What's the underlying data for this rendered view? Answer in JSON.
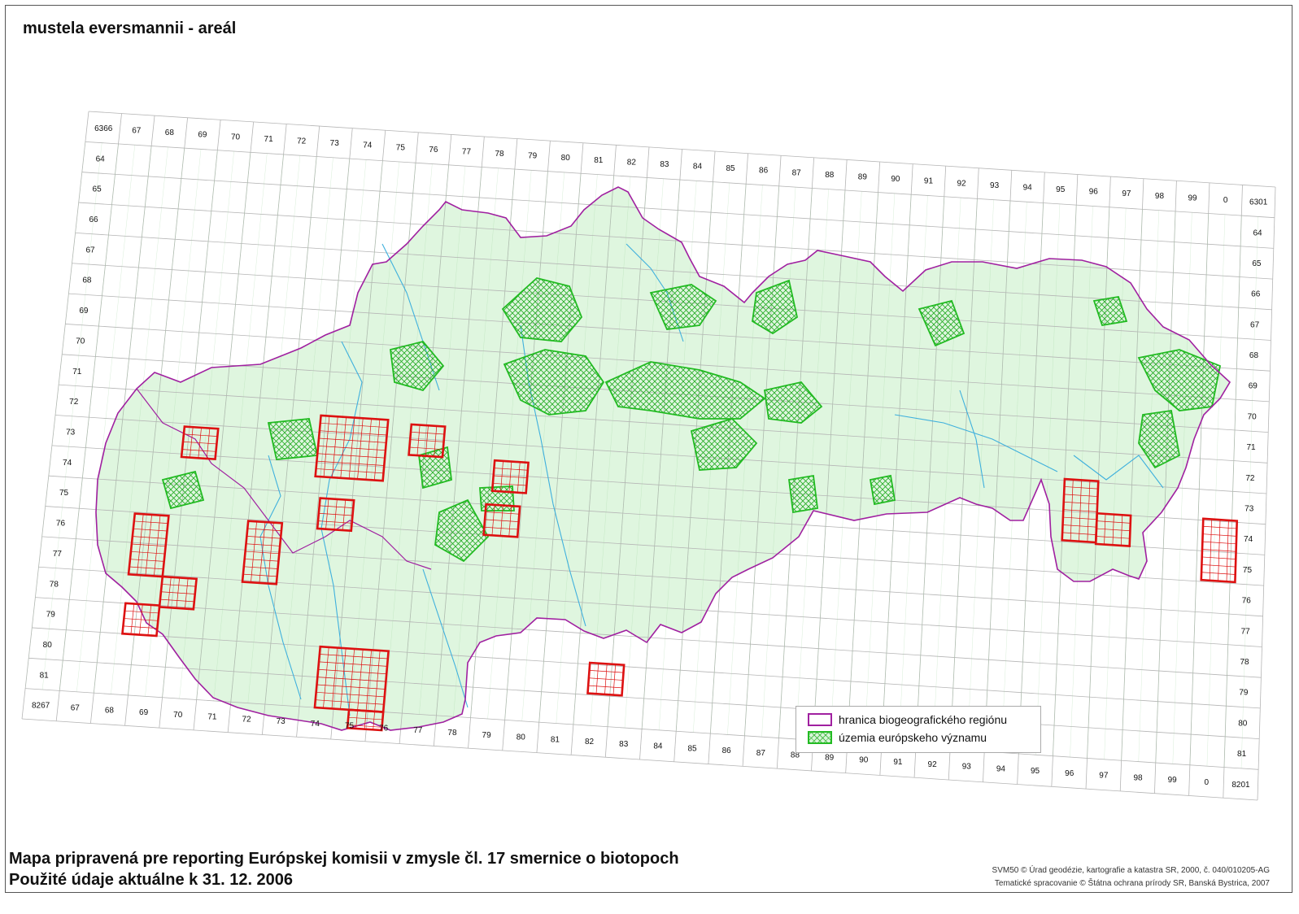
{
  "map": {
    "title": "mustela eversmannii - areál",
    "top_labels": [
      "6366",
      "67",
      "68",
      "69",
      "70",
      "71",
      "72",
      "73",
      "74",
      "75",
      "76",
      "77",
      "78",
      "79",
      "80",
      "81",
      "82",
      "83",
      "84",
      "85",
      "86",
      "87",
      "88",
      "89",
      "90",
      "91",
      "92",
      "93",
      "94",
      "95",
      "96",
      "97",
      "98",
      "99",
      "0",
      "6301"
    ],
    "bottom_labels": [
      "8267",
      "67",
      "68",
      "69",
      "70",
      "71",
      "72",
      "73",
      "74",
      "75",
      "76",
      "77",
      "78",
      "79",
      "80",
      "81",
      "82",
      "83",
      "84",
      "85",
      "86",
      "87",
      "88",
      "89",
      "90",
      "91",
      "92",
      "93",
      "94",
      "95",
      "96",
      "97",
      "98",
      "99",
      "0",
      "8201"
    ],
    "left_labels": [
      "64",
      "65",
      "66",
      "67",
      "68",
      "69",
      "70",
      "71",
      "72",
      "73",
      "74",
      "75",
      "76",
      "77",
      "78",
      "79",
      "80",
      "81"
    ],
    "right_labels": [
      "64",
      "65",
      "66",
      "67",
      "68",
      "69",
      "70",
      "71",
      "72",
      "73",
      "74",
      "75",
      "76",
      "77",
      "78",
      "79",
      "80",
      "81"
    ],
    "colors": {
      "region_boundary": "#a020a0",
      "sci_areas": "#22bb22",
      "land_fill": "#dff6df",
      "occurrence_squares": "#dd1111",
      "rivers": "#3fb0dd",
      "grid": "#b5b5b5"
    }
  },
  "legend": {
    "region_label": "hranica biogeografického regiónu",
    "sci_label": "územia európskeho významu"
  },
  "footer": {
    "line1": "Mapa pripravená pre reporting Európskej komisii v zmysle čl. 17 smernice o biotopoch",
    "line2": "Použité údaje aktuálne k 31. 12. 2006"
  },
  "credits": {
    "line1": "SVM50 © Úrad geodézie, kartografie a katastra SR, 2000, č. 040/010205-AG",
    "line2": "Tematické spracovanie © Štátna ochrana prírody SR, Banská Bystrica, 2007"
  }
}
